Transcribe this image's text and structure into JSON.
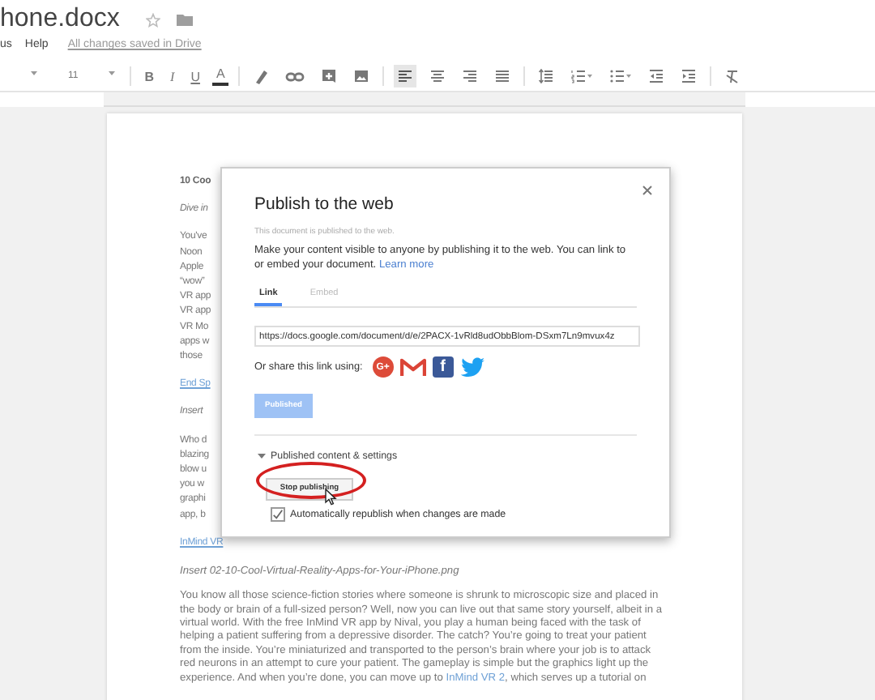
{
  "doc_header": {
    "title": "hone.docx",
    "starred": false
  },
  "menu": [
    {
      "label": "us"
    },
    {
      "label": "Help"
    }
  ],
  "save_status": "All changes saved in Drive",
  "toolbar": [
    {
      "kind": "caret",
      "selected": false
    },
    {
      "kind": "text",
      "label": "11",
      "selected": false
    },
    {
      "kind": "caret",
      "selected": false
    },
    {
      "kind": "bold",
      "label": "B",
      "selected": false
    },
    {
      "kind": "italic",
      "label": "I",
      "selected": false
    },
    {
      "kind": "underline",
      "label": "U",
      "selected": false
    },
    {
      "kind": "color",
      "label": "A",
      "selected": false
    },
    {
      "kind": "highlight",
      "selected": false
    },
    {
      "kind": "link",
      "selected": false
    },
    {
      "kind": "comment",
      "selected": false
    },
    {
      "kind": "image",
      "selected": false
    },
    {
      "kind": "align-left",
      "selected": true
    },
    {
      "kind": "align-center",
      "selected": false
    },
    {
      "kind": "align-right",
      "selected": false
    },
    {
      "kind": "justify",
      "selected": false
    },
    {
      "kind": "line-spacing",
      "selected": false
    },
    {
      "kind": "numbered-list",
      "selected": false
    },
    {
      "kind": "bulleted-list",
      "selected": false
    },
    {
      "kind": "outdent",
      "selected": false
    },
    {
      "kind": "indent",
      "selected": false
    },
    {
      "kind": "clear-format",
      "selected": false
    }
  ],
  "document": [
    {
      "kind": "heading",
      "text": "10 Coo"
    },
    {
      "kind": "italic",
      "text": "Dive in"
    },
    {
      "kind": "lines",
      "lines": [
        "You've",
        "Noon",
        "Apple",
        "“wow”",
        "VR app",
        "VR app",
        "VR Mo",
        "apps w",
        "those"
      ]
    },
    {
      "kind": "link",
      "text": "End Sp"
    },
    {
      "kind": "italic",
      "text": "Insert"
    },
    {
      "kind": "lines",
      "lines": [
        "Who d",
        "blazing",
        "blow u",
        "you w",
        "graphi",
        "app, b"
      ]
    },
    {
      "kind": "link",
      "text": "InMind VR"
    },
    {
      "kind": "italic",
      "text": "Insert 02-10-Cool-Virtual-Reality-Apps-for-Your-iPhone.png"
    },
    {
      "kind": "paragraph",
      "text": "You know all those science-fiction stories where someone is shrunk to microscopic size and placed in the body or brain of a full-sized person? Well, now you can live out that same story yourself, albeit in a virtual world. With the free InMind VR app by Nival, you play a human being faced with the task of helping a patient suffering from a depressive disorder. The catch? You’re going to treat your patient from the inside. You’re miniaturized and transported to the person’s brain where your job is to attack red neurons in an attempt to cure your patient. The gameplay is simple but the graphics light up the experience. And when you’re done, you can move up to ",
      "link": "InMind VR 2",
      "after": ", which serves up a tutorial on"
    }
  ],
  "dialog": {
    "title": "Publish to the web",
    "note": "This document is published to the web.",
    "description": "Make your content visible to anyone by publishing it to the web. You can link to or embed your document.",
    "learn_more": "Learn more",
    "tabs": [
      {
        "label": "Link",
        "selected": true
      },
      {
        "label": "Embed",
        "selected": false
      }
    ],
    "url": "https://docs.google.com/document/d/e/2PACX-1vRld8udObbBlom-DSxm7Ln9mvux4z",
    "share_label": "Or share this link using:",
    "share": [
      {
        "kind": "gplus",
        "label": "G+"
      },
      {
        "kind": "mail"
      },
      {
        "kind": "facebook",
        "label": "f"
      },
      {
        "kind": "twitter"
      }
    ],
    "published_button": {
      "label": "Published",
      "disabled": true
    },
    "section": {
      "label": "Published content & settings",
      "expanded": true
    },
    "stop_button": "Stop publishing",
    "republish": {
      "label": "Automatically republish when changes are made",
      "checked": true
    }
  }
}
